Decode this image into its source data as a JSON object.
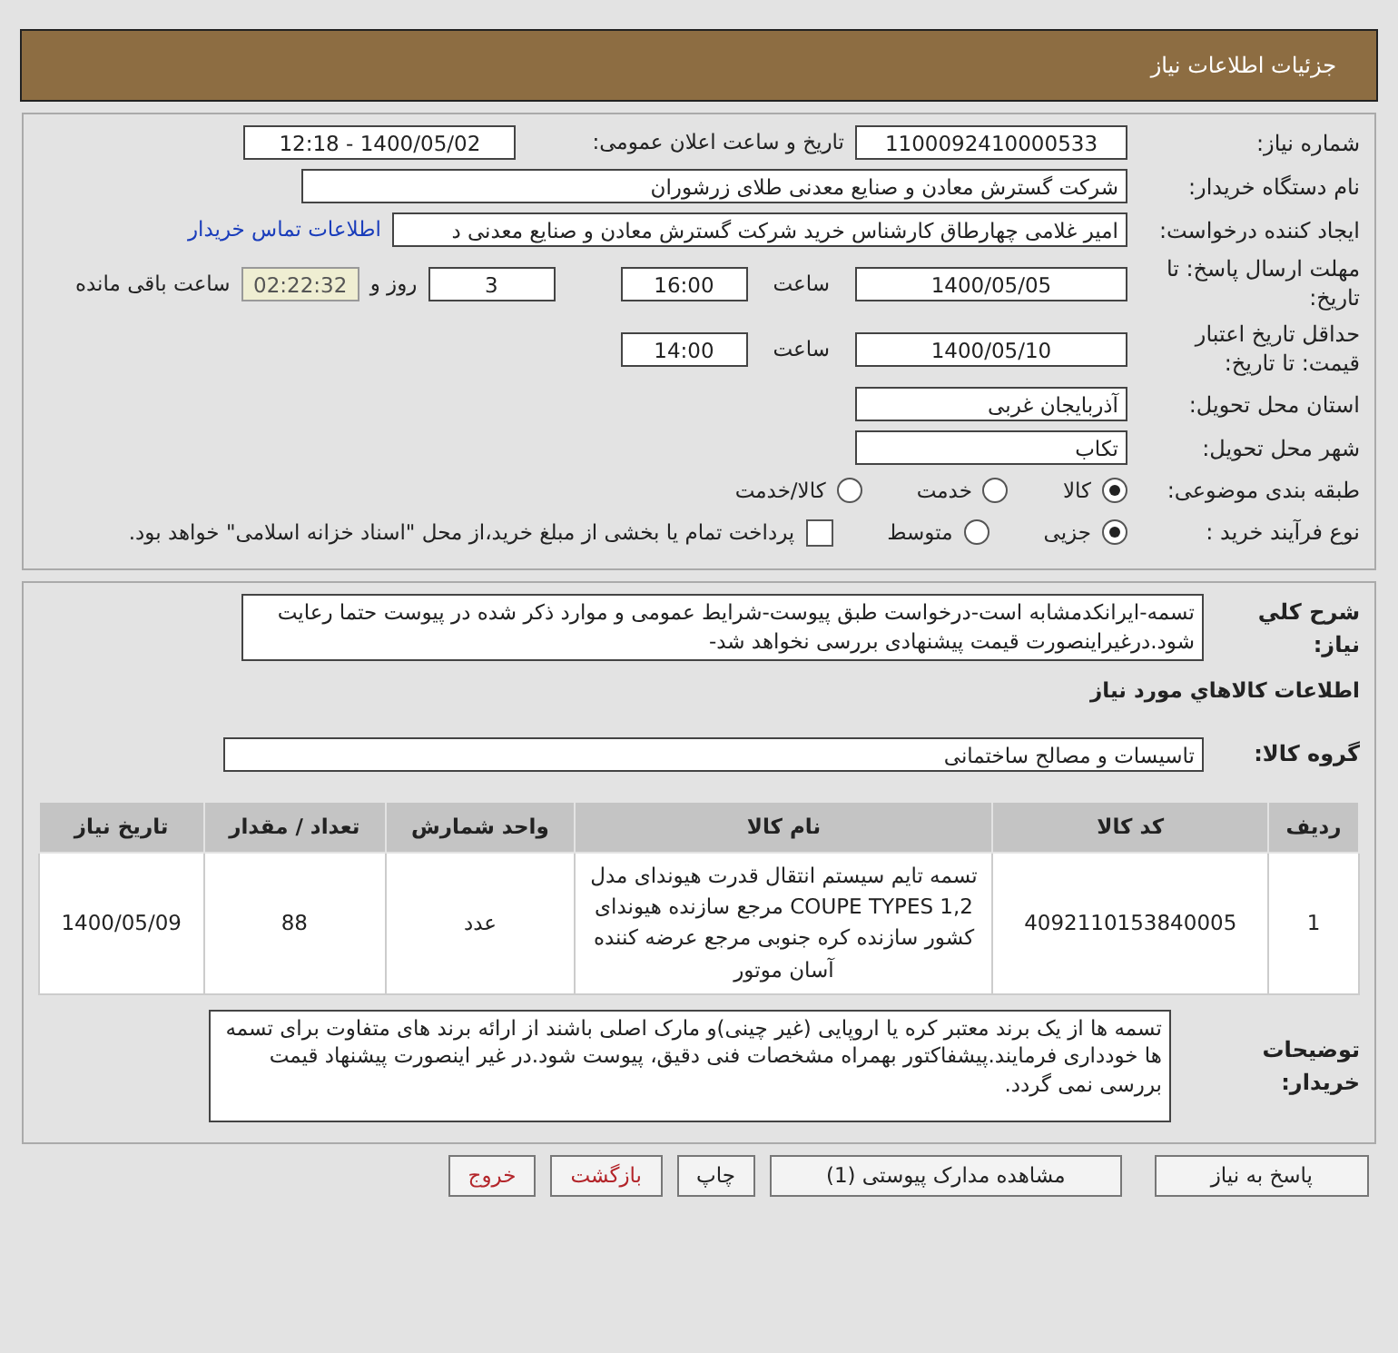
{
  "header": {
    "title": "جزئیات اطلاعات نیاز"
  },
  "need_number": {
    "label": "شماره نیاز:",
    "value": "1100092410000533"
  },
  "announce": {
    "label": "تاریخ و ساعت اعلان عمومی:",
    "value": "1400/05/02 - 12:18"
  },
  "buyer_org": {
    "label": "نام دستگاه خریدار:",
    "value": "شرکت گسترش معادن و صنایع معدنی طلای زرشوران"
  },
  "requester": {
    "label": "ایجاد کننده درخواست:",
    "value": "امیر  غلامی چهارطاق کارشناس خرید شرکت گسترش معادن و صنایع معدنی د",
    "link": "اطلاعات تماس خریدار"
  },
  "reply_deadline": {
    "label": "مهلت ارسال پاسخ: تا تاریخ:",
    "date": "1400/05/05",
    "time_label": "ساعت",
    "time": "16:00",
    "days": "3",
    "days_label": "روز و",
    "remaining": "02:22:32",
    "remaining_label": "ساعت باقی مانده"
  },
  "price_validity": {
    "label": "حداقل تاریخ اعتبار قیمت: تا تاریخ:",
    "date": "1400/05/10",
    "time_label": "ساعت",
    "time": "14:00"
  },
  "province": {
    "label": "استان محل تحویل:",
    "value": "آذربایجان غربی"
  },
  "city": {
    "label": "شهر محل تحویل:",
    "value": "تکاب"
  },
  "category": {
    "label": "طبقه بندی موضوعی:",
    "options": [
      {
        "label": "کالا",
        "selected": true
      },
      {
        "label": "خدمت",
        "selected": false
      },
      {
        "label": "کالا/خدمت",
        "selected": false
      }
    ]
  },
  "purchase_type": {
    "label": "نوع فرآیند خرید :",
    "options": [
      {
        "label": "جزیی",
        "selected": true
      },
      {
        "label": "متوسط",
        "selected": false
      }
    ],
    "payment": {
      "checked": false,
      "text": "پرداخت تمام یا بخشی از مبلغ خرید،از محل \"اسناد خزانه اسلامی\" خواهد بود."
    }
  },
  "description": {
    "label": "شرح کلي نياز:",
    "value": "تسمه-ایرانکدمشابه است-درخواست طبق پیوست-شرایط عمومی و موارد ذکر شده در پیوست حتما رعایت شود.درغیراینصورت قیمت پیشنهادی بررسی نخواهد شد-"
  },
  "goods_heading": "اطلاعات کالاهاي مورد نياز",
  "goods_group": {
    "label": "گروه کالا:",
    "value": "تاسیسات و مصالح ساختمانی"
  },
  "table": {
    "columns": [
      "ردیف",
      "کد کالا",
      "نام کالا",
      "واحد شمارش",
      "تعداد / مقدار",
      "تاریخ نیاز"
    ],
    "rows": [
      [
        "1",
        "4092110153840005",
        "تسمه تایم سیستم انتقال قدرت هیوندای مدل COUPE TYPES 1,2 مرجع سازنده هیوندای کشور سازنده کره جنوبی مرجع عرضه کننده آسان موتور",
        "عدد",
        "88",
        "1400/05/09"
      ]
    ]
  },
  "buyer_notes": {
    "label": "توضیحات خریدار:",
    "value": "تسمه ها از یک برند معتبر کره یا اروپایی (غیر چینی)و مارک اصلی باشند از ارائه برند های متفاوت برای تسمه ها خودداری فرمایند.پیشفاکتور بهمراه مشخصات فنی دقیق، پیوست شود.در غیر اینصورت پیشنهاد قیمت بررسی نمی گردد."
  },
  "buttons": [
    {
      "label": "پاسخ به نیاز",
      "kind": "normal"
    },
    {
      "label": "مشاهده مدارک پیوستی (1)",
      "kind": "normal"
    },
    {
      "label": "چاپ",
      "kind": "normal"
    },
    {
      "label": "بازگشت",
      "kind": "danger"
    },
    {
      "label": "خروج",
      "kind": "danger"
    }
  ]
}
